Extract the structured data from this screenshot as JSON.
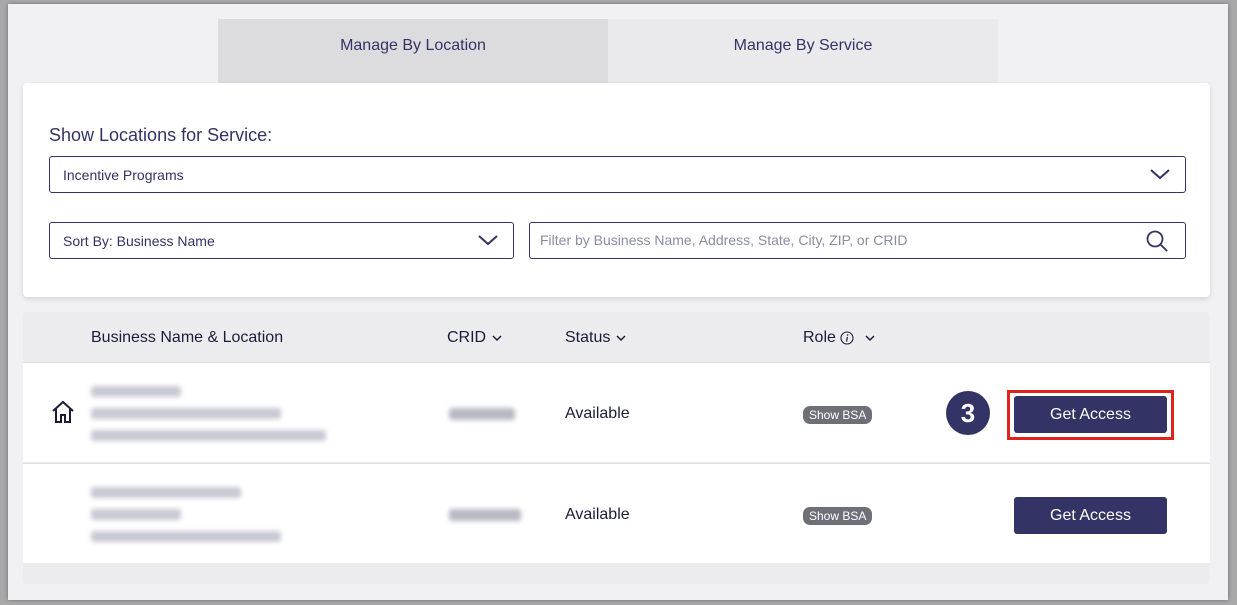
{
  "tabs": [
    {
      "label": "Manage By Location",
      "active": true
    },
    {
      "label": "Manage By Service",
      "active": false
    }
  ],
  "filters": {
    "heading": "Show Locations for Service:",
    "service_value": "Incentive Programs",
    "sort_value": "Sort By: Business Name",
    "search_placeholder": "Filter by Business Name, Address, State, City, ZIP, or CRID"
  },
  "table": {
    "headers": {
      "business": "Business Name & Location",
      "crid": "CRID",
      "status": "Status",
      "role": "Role"
    },
    "rows": [
      {
        "status": "Available",
        "role_badge": "Show BSA",
        "action": "Get Access",
        "highlighted": true,
        "step": "3"
      },
      {
        "status": "Available",
        "role_badge": "Show BSA",
        "action": "Get Access",
        "highlighted": false
      }
    ]
  },
  "colors": {
    "primary": "#333366",
    "highlight": "#e0211c",
    "badge": "#6f6f78"
  },
  "icons": [
    "home-icon",
    "chevron-down-icon",
    "search-icon",
    "info-icon",
    "sort-caret-icon"
  ]
}
